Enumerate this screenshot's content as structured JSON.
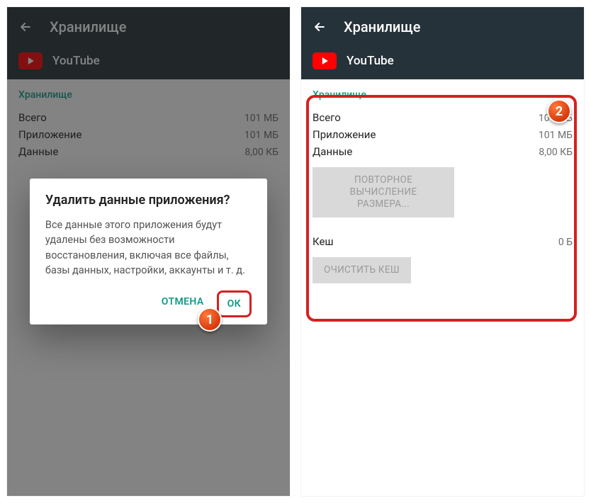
{
  "appbar": {
    "title": "Хранилище"
  },
  "app": {
    "name": "YouTube"
  },
  "section": {
    "label": "Хранилище"
  },
  "rows": {
    "total": {
      "label": "Всего",
      "value": "101 МБ"
    },
    "appsize": {
      "label": "Приложение",
      "value": "101 МБ"
    },
    "data": {
      "label": "Данные",
      "value": "8,00 КБ"
    },
    "cache": {
      "label": "Кеш",
      "value": "0 Б"
    }
  },
  "buttons": {
    "recompute": "ПОВТОРНОЕ ВЫЧИСЛЕНИЕ РАЗМЕРА...",
    "clear_cache": "ОЧИСТИТЬ КЕШ"
  },
  "dialog": {
    "title": "Удалить данные приложения?",
    "body": "Все данные этого приложения будут удалены без возможности восстановления, включая все файлы, базы данных, настройки, аккаунты и т. д.",
    "cancel": "ОТМЕНА",
    "ok": "ОК"
  },
  "badges": {
    "one": "1",
    "two": "2"
  }
}
